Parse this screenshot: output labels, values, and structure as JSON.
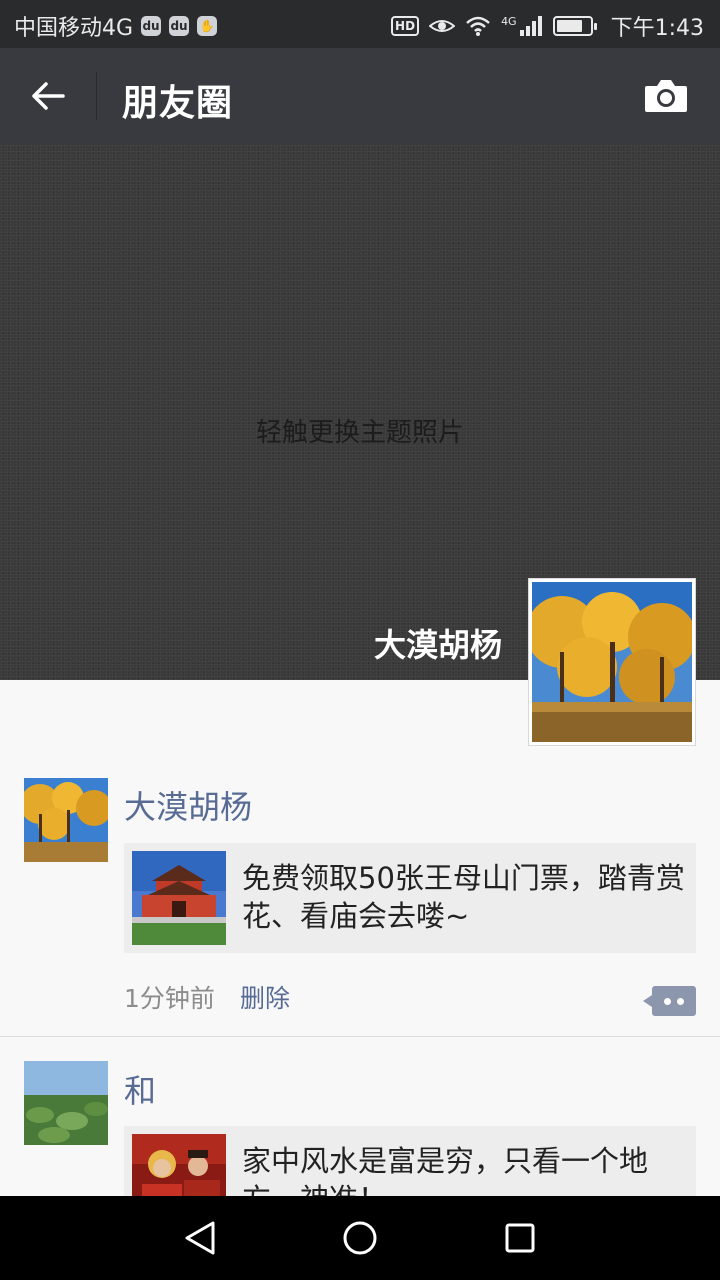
{
  "status_bar": {
    "carrier": "中国移动4G",
    "hd": "HD",
    "network": "4G",
    "time": "下午1:43"
  },
  "nav": {
    "title": "朋友圈",
    "back_icon": "arrow-left-icon",
    "camera_icon": "camera-icon"
  },
  "cover": {
    "hint": "轻触更换主题照片",
    "profile_name": "大漠胡杨"
  },
  "posts": [
    {
      "name": "大漠胡杨",
      "share_text": "免费领取50张王母山门票，踏青赏花、看庙会去喽~",
      "time": "1分钟前",
      "delete": "删除"
    },
    {
      "name": "和",
      "share_text": "家中风水是富是穷，只看一个地方，神准！"
    }
  ],
  "colors": {
    "nav_bg": "#393a3f",
    "link": "#576b95",
    "status_bg": "#2a2b2d"
  }
}
